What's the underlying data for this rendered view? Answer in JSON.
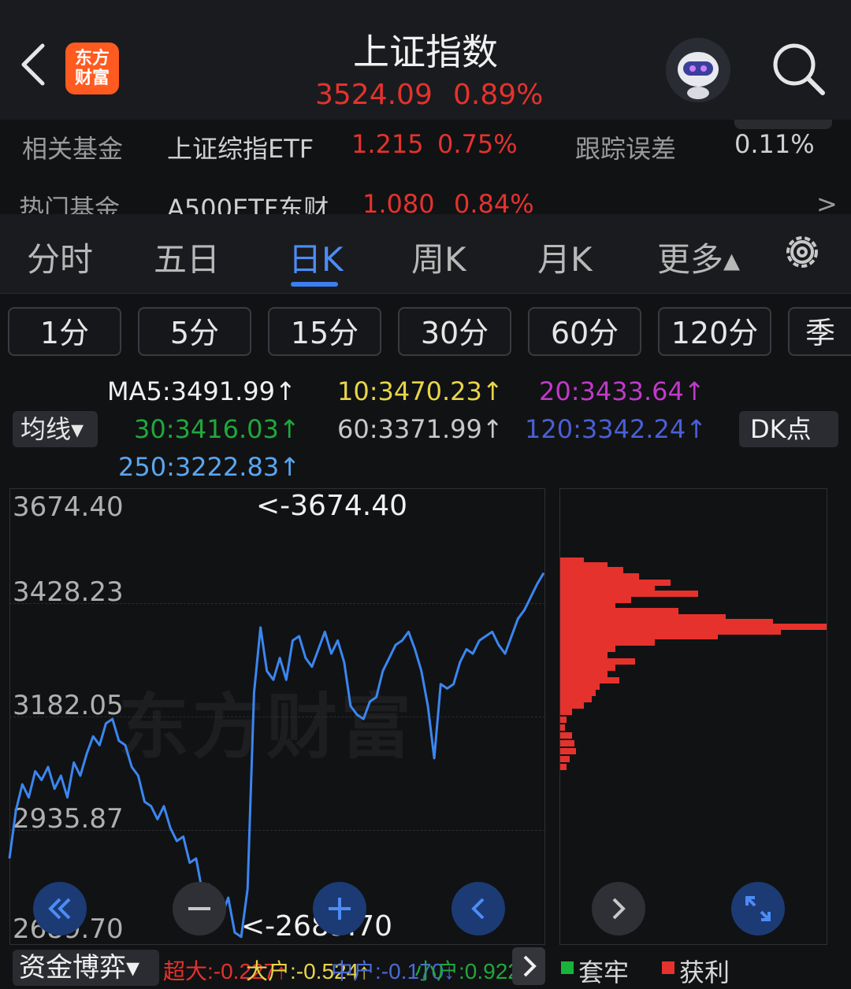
{
  "header": {
    "title": "上证指数",
    "price": "3524.09",
    "change_pct": "0.89%",
    "logo_line1": "东方",
    "logo_line2": "财富"
  },
  "fund_rows": [
    {
      "label": "相关基金",
      "name": "上证综指ETF",
      "value": "1.215",
      "pct": "0.75%",
      "extra": "跟踪误差",
      "extra_value": "0.11%"
    },
    {
      "label": "热门基金",
      "name": "A500ETF东财",
      "value": "1.080",
      "pct": "0.84%",
      "arrow": ">"
    }
  ],
  "tabs": [
    {
      "label": "分时"
    },
    {
      "label": "五日"
    },
    {
      "label": "日K"
    },
    {
      "label": "周K"
    },
    {
      "label": "月K"
    },
    {
      "label": "更多▴"
    }
  ],
  "intervals": [
    "1分",
    "5分",
    "15分",
    "30分",
    "60分",
    "120分",
    "季"
  ],
  "ma": {
    "dropdown": "均线▾",
    "ma5": "MA5:3491.99↑",
    "ma10": "10:3470.23↑",
    "ma20": "20:3433.64↑",
    "ma30": "30:3416.03↑",
    "ma60": "60:3371.99↑",
    "ma120": "120:3342.24↑",
    "ma250": "250:3222.83↑",
    "dk_button": "DK点"
  },
  "chart": {
    "y_labels": [
      "3674.40",
      "3428.23",
      "3182.05",
      "2935.87",
      "2689.70"
    ],
    "max_annotation": "<-3674.40",
    "min_annotation": "<-2689.70",
    "watermark": "东方财富",
    "line_color": "#3b86f0"
  },
  "chart_data": {
    "type": "line",
    "ylim": [
      2689.7,
      3674.4
    ],
    "y_ticks": [
      3674.4,
      3428.23,
      3182.05,
      2935.87,
      2689.7
    ],
    "series": [
      {
        "values": [
          2870,
          2980,
          3040,
          3010,
          3070,
          3050,
          3080,
          3030,
          3060,
          3010,
          3090,
          3060,
          3110,
          3150,
          3130,
          3180,
          3190,
          3140,
          3130,
          3080,
          3060,
          3000,
          2990,
          2960,
          2990,
          2940,
          2910,
          2920,
          2860,
          2870,
          2790,
          2810,
          2760,
          2740,
          2780,
          2700,
          2690,
          2800,
          3250,
          3400,
          3300,
          3280,
          3330,
          3280,
          3370,
          3380,
          3330,
          3310,
          3350,
          3390,
          3340,
          3370,
          3320,
          3220,
          3200,
          3190,
          3230,
          3240,
          3300,
          3330,
          3360,
          3370,
          3390,
          3350,
          3300,
          3220,
          3100,
          3270,
          3260,
          3270,
          3320,
          3350,
          3340,
          3370,
          3380,
          3390,
          3360,
          3340,
          3380,
          3420,
          3440,
          3470,
          3500,
          3525
        ]
      }
    ]
  },
  "distribution": {
    "profit_color": "#e5322d",
    "trapped_color": "#19b33a"
  },
  "bottom": {
    "fund_game": "资金博弈▾",
    "super_large": "超大:-0.227↑",
    "large": "大户:-0.524↑",
    "medium": "中户:-0.170↓",
    "small": "小户:0.922↓",
    "legend_trapped": "套牢",
    "legend_profit": "获利"
  }
}
